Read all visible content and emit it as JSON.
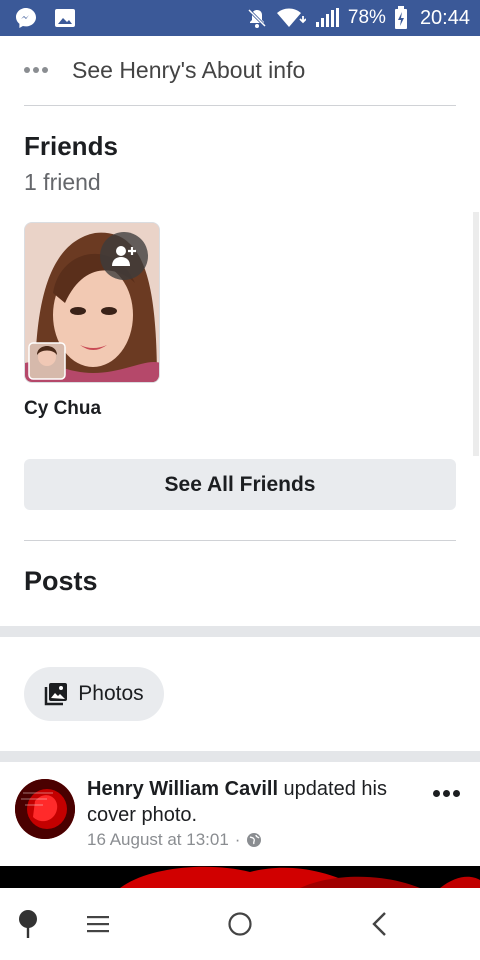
{
  "status_bar": {
    "battery": "78%",
    "time": "20:44",
    "icons": [
      "messenger-icon",
      "image-icon",
      "mute-icon",
      "wifi-icon",
      "signal-icon",
      "battery-charging-icon"
    ],
    "color": "#3b5998"
  },
  "about": {
    "label": "See Henry's About info"
  },
  "friends": {
    "title": "Friends",
    "count": "1 friend",
    "items": [
      {
        "name": "Cy Chua"
      }
    ],
    "see_all_label": "See All Friends"
  },
  "posts": {
    "title": "Posts",
    "photos_label": "Photos",
    "post": {
      "author": "Henry William Cavill",
      "action": " updated his cover photo.",
      "timestamp": "16 August at 13:01",
      "separator": "·"
    }
  },
  "nav": {
    "icons": [
      "assistant-icon",
      "menu-icon",
      "home-icon",
      "back-icon"
    ]
  }
}
